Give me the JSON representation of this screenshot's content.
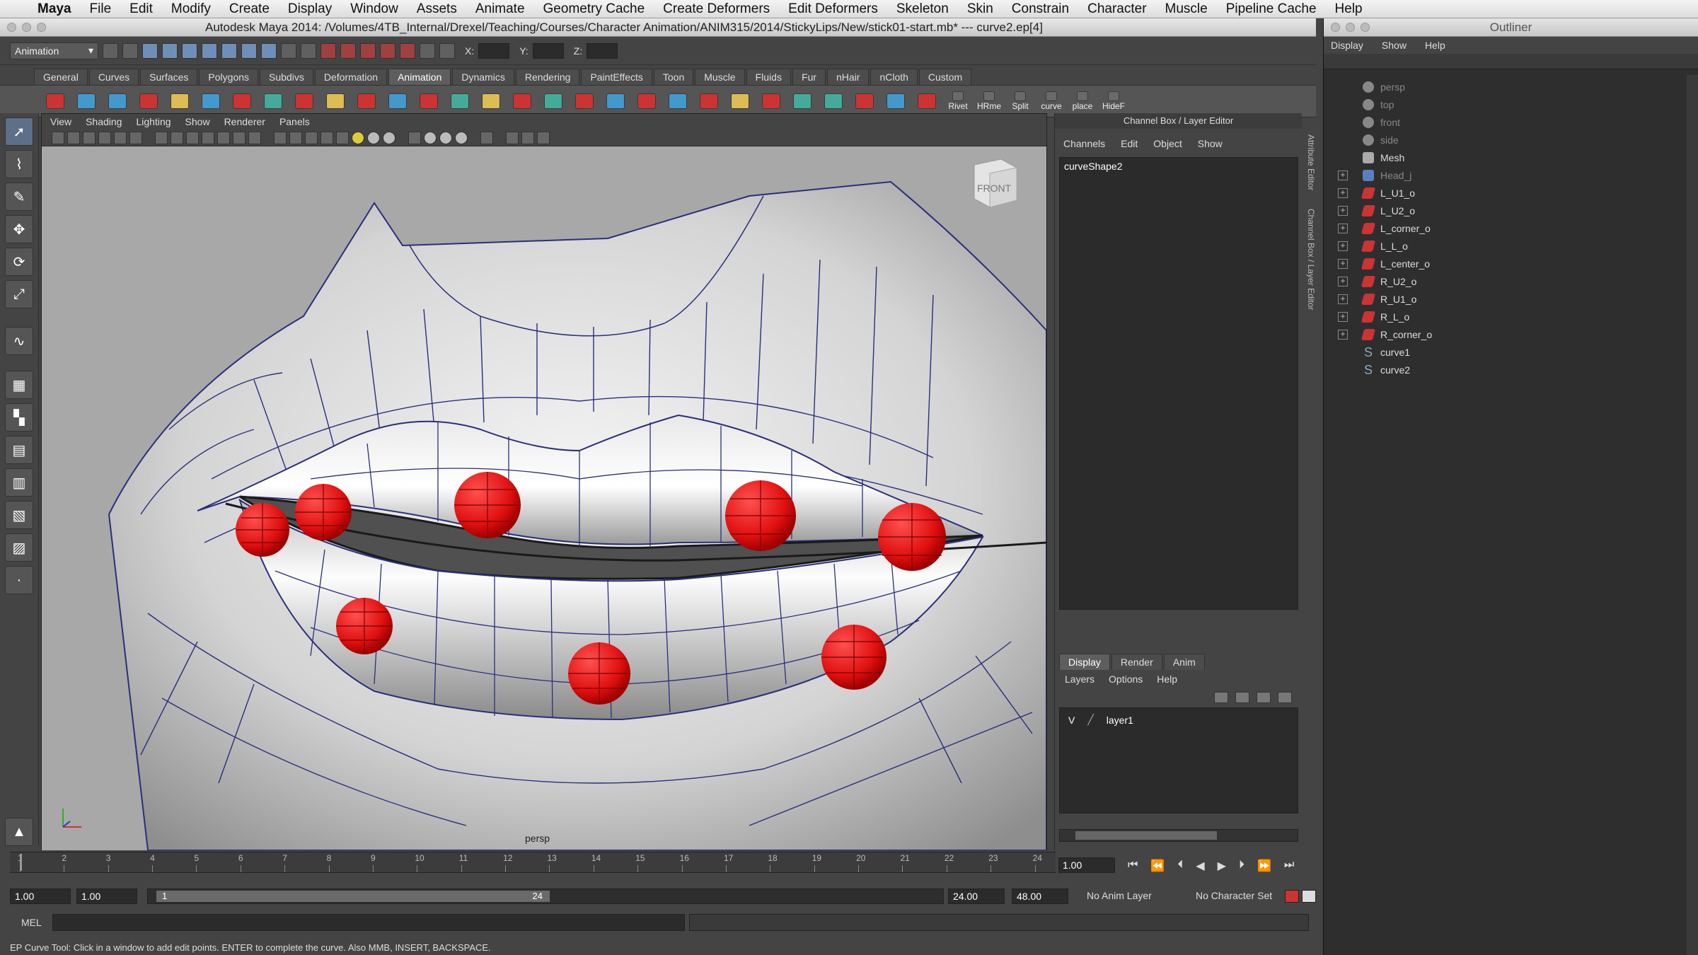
{
  "macmenu": {
    "app": "Maya",
    "items": [
      "File",
      "Edit",
      "Modify",
      "Create",
      "Display",
      "Window",
      "Assets",
      "Animate",
      "Geometry Cache",
      "Create Deformers",
      "Edit Deformers",
      "Skeleton",
      "Skin",
      "Constrain",
      "Character",
      "Muscle",
      "Pipeline Cache",
      "Help"
    ]
  },
  "window": {
    "title": "Autodesk Maya 2014: /Volumes/4TB_Internal/Drexel/Teaching/Courses/Character Animation/ANIM315/2014/StickyLips/New/stick01-start.mb*  ---  curve2.ep[4]"
  },
  "statusline": {
    "mode": "Animation",
    "x_label": "X:",
    "y_label": "Y:",
    "z_label": "Z:"
  },
  "shelf": {
    "tabs": [
      "General",
      "Curves",
      "Surfaces",
      "Polygons",
      "Subdivs",
      "Deformation",
      "Animation",
      "Dynamics",
      "Rendering",
      "PaintEffects",
      "Toon",
      "Muscle",
      "Fluids",
      "Fur",
      "nHair",
      "nCloth",
      "Custom"
    ],
    "active_tab": "Animation",
    "labeled_icons": [
      "Rivet",
      "HRme",
      "Split",
      "curve",
      "place",
      "HideF"
    ]
  },
  "panel": {
    "menu": [
      "View",
      "Shading",
      "Lighting",
      "Show",
      "Renderer",
      "Panels"
    ],
    "camera_label": "persp",
    "viewcube_label": "FRONT"
  },
  "channel_box": {
    "title": "Channel Box / Layer Editor",
    "menu": [
      "Channels",
      "Edit",
      "Object",
      "Show"
    ],
    "node": "curveShape2",
    "layer_tabs": [
      "Display",
      "Render",
      "Anim"
    ],
    "active_layer_tab": "Display",
    "layer_menu": [
      "Layers",
      "Options",
      "Help"
    ],
    "layers": [
      {
        "visible": "V",
        "name": "layer1"
      }
    ]
  },
  "side_tabs": [
    "Attribute Editor",
    "Channel Box / Layer Editor"
  ],
  "timeline": {
    "ticks": [
      "1",
      "2",
      "3",
      "4",
      "5",
      "6",
      "7",
      "8",
      "9",
      "10",
      "11",
      "12",
      "13",
      "14",
      "15",
      "16",
      "17",
      "18",
      "19",
      "20",
      "21",
      "22",
      "23",
      "24"
    ],
    "current_frame": "1.00"
  },
  "range": {
    "start": "1.00",
    "playback_start": "1.00",
    "slider_start": "1",
    "slider_end": "24",
    "playback_end": "24.00",
    "end": "48.00",
    "anim_layer": "No Anim Layer",
    "character_set": "No Character Set"
  },
  "command": {
    "label": "MEL",
    "help_line": "EP Curve Tool: Click in a window to add edit points. ENTER to complete the curve. Also MMB, INSERT, BACKSPACE."
  },
  "outliner": {
    "title": "Outliner",
    "menu": [
      "Display",
      "Show",
      "Help"
    ],
    "items": [
      {
        "name": "persp",
        "icon": "camera-icon",
        "dim": true,
        "expandable": false
      },
      {
        "name": "top",
        "icon": "camera-icon",
        "dim": true,
        "expandable": false
      },
      {
        "name": "front",
        "icon": "camera-icon",
        "dim": true,
        "expandable": false
      },
      {
        "name": "side",
        "icon": "camera-icon",
        "dim": true,
        "expandable": false
      },
      {
        "name": "Mesh",
        "icon": "mesh-icon",
        "dim": false,
        "expandable": false
      },
      {
        "name": "Head_j",
        "icon": "joint-icon",
        "dim": true,
        "expandable": true
      },
      {
        "name": "L_U1_o",
        "icon": "control-icon",
        "dim": false,
        "expandable": true
      },
      {
        "name": "L_U2_o",
        "icon": "control-icon",
        "dim": false,
        "expandable": true
      },
      {
        "name": "L_corner_o",
        "icon": "control-icon",
        "dim": false,
        "expandable": true
      },
      {
        "name": "L_L_o",
        "icon": "control-icon",
        "dim": false,
        "expandable": true
      },
      {
        "name": "L_center_o",
        "icon": "control-icon",
        "dim": false,
        "expandable": true
      },
      {
        "name": "R_U2_o",
        "icon": "control-icon",
        "dim": false,
        "expandable": true
      },
      {
        "name": "R_U1_o",
        "icon": "control-icon",
        "dim": false,
        "expandable": true
      },
      {
        "name": "R_L_o",
        "icon": "control-icon",
        "dim": false,
        "expandable": true
      },
      {
        "name": "R_corner_o",
        "icon": "control-icon",
        "dim": false,
        "expandable": true
      },
      {
        "name": "curve1",
        "icon": "curve-icon",
        "dim": false,
        "expandable": false
      },
      {
        "name": "curve2",
        "icon": "curve-icon",
        "dim": false,
        "expandable": false
      }
    ]
  },
  "colors": {
    "control_sphere": "#e01010",
    "wireframe": "#2a2f7a",
    "viewport_bg": "#a8a8a8"
  }
}
